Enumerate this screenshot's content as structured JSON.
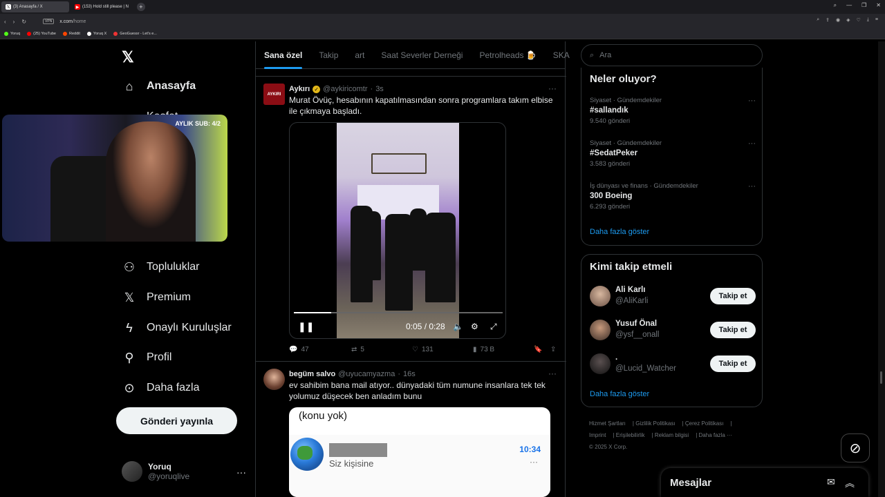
{
  "browser": {
    "tabs": [
      {
        "label": "(3) Anasayfa / X",
        "active": true
      },
      {
        "label": "(153) Hold still please | N",
        "active": false
      }
    ],
    "vpn_label": "VPN",
    "url_domain": "x.com",
    "url_path": "/home",
    "bookmarks": [
      "Yoruq",
      "(25) YouTube",
      "Reddit",
      "Yoruq X",
      "GeoGuessr - Let's e..."
    ]
  },
  "left_nav": {
    "items": [
      {
        "label": "Anasayfa",
        "icon": "home-icon",
        "bold": true
      },
      {
        "label": "Keşfet",
        "icon": "search-icon"
      },
      {
        "label": "Topluluklar",
        "icon": "communities-icon"
      },
      {
        "label": "Premium",
        "icon": "x-icon"
      },
      {
        "label": "Onaylı Kuruluşlar",
        "icon": "lightning-icon"
      },
      {
        "label": "Profil",
        "icon": "person-icon"
      },
      {
        "label": "Daha fazla",
        "icon": "more-circle-icon"
      }
    ],
    "post_button": "Gönderi yayınla",
    "account": {
      "name": "Yoruq",
      "handle": "@yoruqlive"
    }
  },
  "webcam_overlay": {
    "sub_text": "AYLIK SUB: 4/2"
  },
  "feed": {
    "tabs": [
      "Sana özel",
      "Takip",
      "art",
      "Saat Severler Derneği",
      "Petrolheads 🍺",
      "SKA"
    ],
    "tweets": [
      {
        "avatar_text": "AYKIRI",
        "name": "Aykırı",
        "handle": "@aykiricomtr",
        "time": "3s",
        "text": "Murat Övüç, hesabının kapatılmasından sonra programlara takım elbise ile çıkmaya başladı.",
        "video": {
          "time": "0:05 / 0:28",
          "progress": 0.18
        },
        "stats": {
          "replies": "47",
          "reposts": "5",
          "likes": "131",
          "views": "73 B"
        }
      },
      {
        "name": "begüm salvo",
        "handle": "@uyucamyazma",
        "time": "16s",
        "text": "ev sahibim bana mail atıyor.. dünyadaki tüm numune insanlara tek tek yolumuz düşecek ben anladım bunu",
        "card": {
          "title": "(konu yok)",
          "subtitle": "Siz kişisine",
          "time": "10:34"
        }
      }
    ]
  },
  "right": {
    "search_placeholder": "Ara",
    "trends_title": "Neler oluyor?",
    "trends": [
      {
        "category": "Siyaset · Gündemdekiler",
        "tag": "#sallandık",
        "count": "9.540 gönderi"
      },
      {
        "category": "Siyaset · Gündemdekiler",
        "tag": "#SedatPeker",
        "count": "3.583 gönderi"
      },
      {
        "category": "İş dünyası ve finans · Gündemdekiler",
        "tag": "300 Boeing",
        "count": "6.293 gönderi"
      }
    ],
    "show_more": "Daha fazla göster",
    "follow_title": "Kimi takip etmeli",
    "follow": [
      {
        "name": "Ali Karlı",
        "handle": "@AliKarli"
      },
      {
        "name": "Yusuf Önal",
        "handle": "@ysf__onall"
      },
      {
        "name": ".",
        "handle": "@Lucid_Watcher"
      }
    ],
    "follow_button": "Takip et",
    "footer": [
      "Hizmet Şartları",
      "Gizlilik Politikası",
      "Çerez Politikası",
      "Imprint",
      "Erişilebilirlik",
      "Reklam bilgisi",
      "Daha fazla ···",
      "© 2025 X Corp."
    ]
  },
  "messages": {
    "title": "Mesajlar"
  }
}
